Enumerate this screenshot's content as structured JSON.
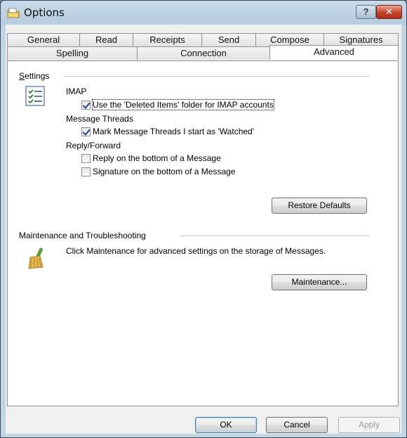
{
  "window": {
    "title": "Options"
  },
  "tabs": {
    "row_top": [
      "General",
      "Read",
      "Receipts",
      "Send",
      "Compose",
      "Signatures"
    ],
    "row_bottom": [
      "Spelling",
      "Connection",
      "Advanced"
    ],
    "active": "Advanced"
  },
  "settings": {
    "group_label": "Settings",
    "imap_label": "IMAP",
    "imap_option": "Use the 'Deleted Items' folder for IMAP accounts",
    "imap_option_checked": true,
    "threads_label": "Message Threads",
    "threads_option": "Mark Message Threads I start as 'Watched'",
    "threads_option_checked": true,
    "reply_label": "Reply/Forward",
    "reply_option": "Reply on the bottom of a Message",
    "reply_option_checked": false,
    "signature_option": "Signature on the bottom of a Message",
    "signature_option_checked": false,
    "restore_button": "Restore Defaults"
  },
  "maintenance": {
    "group_label": "Maintenance and Troubleshooting",
    "description": "Click Maintenance for advanced settings on the storage of Messages.",
    "button": "Maintenance..."
  },
  "footer": {
    "ok": "OK",
    "cancel": "Cancel",
    "apply": "Apply"
  },
  "icons": {
    "app": "options-app-icon",
    "settings": "checklist-icon",
    "maintenance": "broom-icon",
    "help": "help-icon",
    "close": "close-icon"
  }
}
